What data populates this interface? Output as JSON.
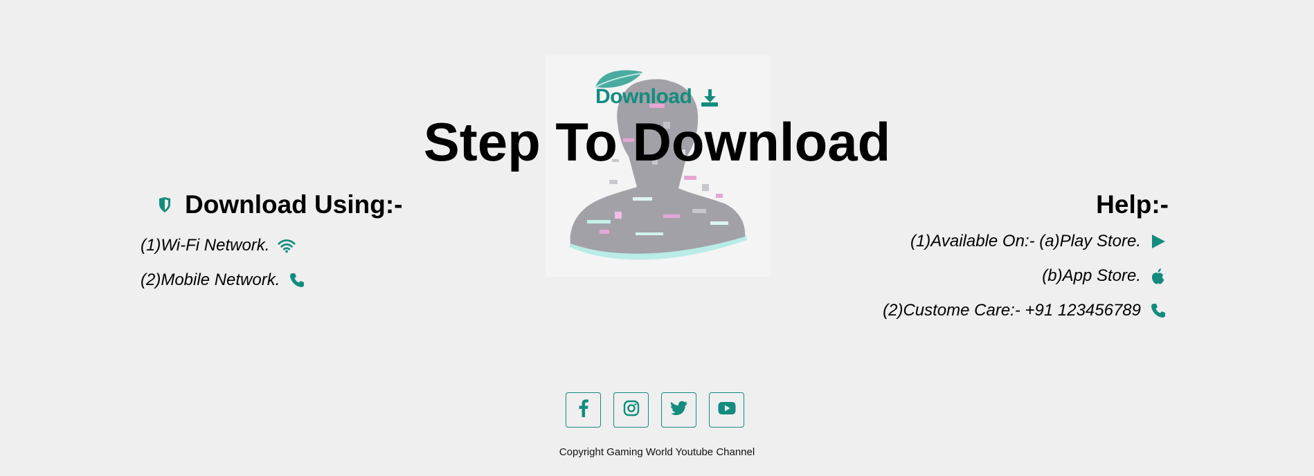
{
  "hero": {
    "logo_text": "Download",
    "title": "Step To Download"
  },
  "left": {
    "heading": "Download Using:-",
    "items": [
      {
        "label": "(1)Wi-Fi Network.",
        "icon": "wifi-icon"
      },
      {
        "label": "(2)Mobile Network.",
        "icon": "phone-icon"
      }
    ],
    "heading_icon": "shield-icon"
  },
  "right": {
    "heading": "Help:-",
    "items": [
      {
        "label": "(1)Available On:- (a)Play Store.",
        "icon": "play-icon"
      },
      {
        "label": "(b)App Store.",
        "icon": "apple-icon"
      },
      {
        "label": "(2)Custome Care:- +91 123456789",
        "icon": "phone-icon"
      }
    ]
  },
  "social": [
    {
      "name": "facebook",
      "icon": "facebook-icon"
    },
    {
      "name": "instagram",
      "icon": "instagram-icon"
    },
    {
      "name": "twitter",
      "icon": "twitter-icon"
    },
    {
      "name": "youtube",
      "icon": "youtube-icon"
    }
  ],
  "footer": {
    "copyright": "Copyright Gaming World Youtube Channel"
  },
  "colors": {
    "accent": "#128c7e",
    "background": "#efefef"
  }
}
